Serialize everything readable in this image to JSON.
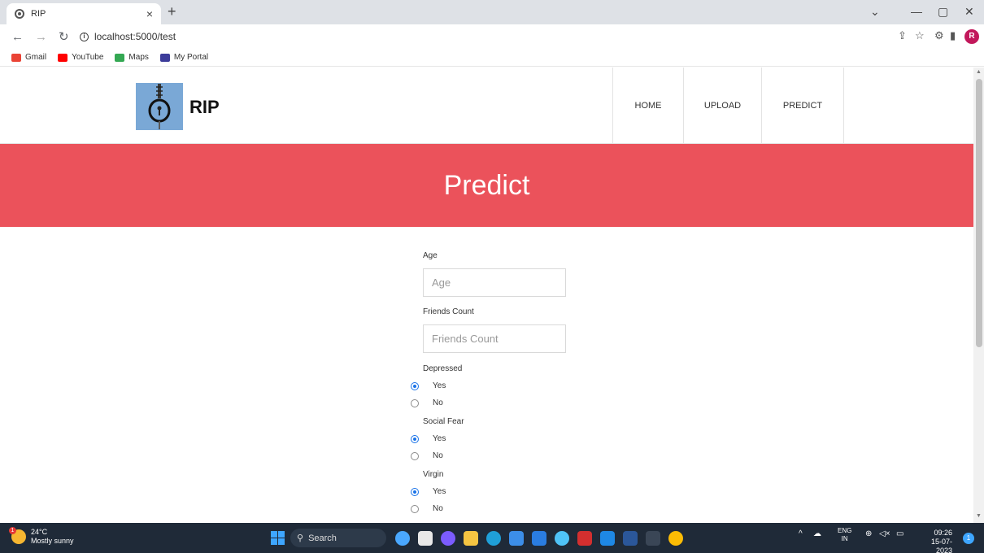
{
  "browser": {
    "tab_title": "RIP",
    "tab_close": "×",
    "new_tab": "+",
    "url": "localhost:5000/test",
    "bookmarks": [
      "Gmail",
      "YouTube",
      "Maps",
      "My Portal"
    ],
    "window": {
      "minimize": "—",
      "restore": "▢",
      "close": "✕",
      "tab_list": "⌄"
    }
  },
  "site": {
    "brand": "RIP",
    "nav": [
      "HOME",
      "UPLOAD",
      "PREDICT"
    ]
  },
  "hero": {
    "title": "Predict"
  },
  "form": {
    "age": {
      "label": "Age",
      "placeholder": "Age",
      "value": ""
    },
    "friends": {
      "label": "Friends Count",
      "placeholder": "Friends Count",
      "value": ""
    },
    "depressed": {
      "label": "Depressed",
      "options": [
        "Yes",
        "No"
      ],
      "selected": "Yes"
    },
    "social_fear": {
      "label": "Social Fear",
      "options": [
        "Yes",
        "No"
      ],
      "selected": "Yes"
    },
    "virgin": {
      "label": "Virgin",
      "options": [
        "Yes",
        "No"
      ],
      "selected": "Yes"
    }
  },
  "taskbar": {
    "weather_temp": "24°C",
    "weather_desc": "Mostly sunny",
    "weather_badge": "1",
    "search_label": "Search",
    "lang_top": "ENG",
    "lang_bottom": "IN",
    "time": "09:26",
    "date": "15-07-2023",
    "notifications": "1"
  },
  "colors": {
    "hero_bg": "#eb525b",
    "taskbar_bg": "#1f2a38",
    "radio_accent": "#1a73e8",
    "logo_bg": "#7aa8d6"
  }
}
